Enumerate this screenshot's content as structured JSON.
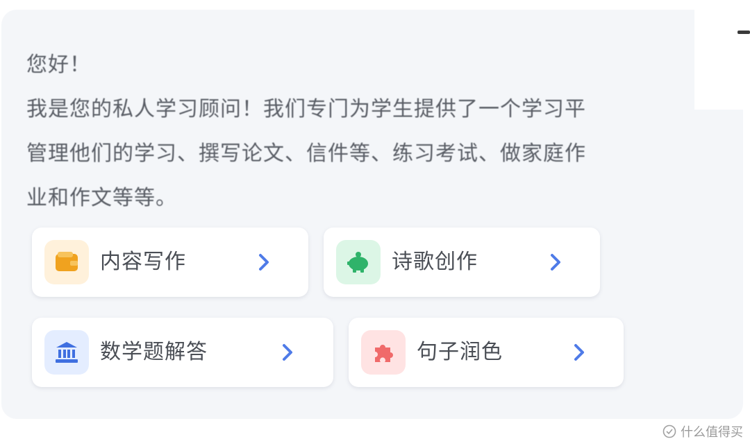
{
  "message": {
    "greeting": "您好！",
    "line1": "我是您的私人学习顾问！我们专门为学生提供了一个学习平",
    "line2": "管理他们的学习、撰写论文、信件等、练习考试、做家庭作",
    "line3": "业和作文等等。"
  },
  "cards": [
    {
      "label": "内容写作",
      "icon": "wallet-icon",
      "icon_bg": "#fff1db",
      "icon_color": "#f0a21f"
    },
    {
      "label": "诗歌创作",
      "icon": "piggy-bank-icon",
      "icon_bg": "#dcf6e6",
      "icon_color": "#2fb36a"
    },
    {
      "label": "数学题解答",
      "icon": "bank-icon",
      "icon_bg": "#e4edff",
      "icon_color": "#3f6fe0"
    },
    {
      "label": "句子润色",
      "icon": "puzzle-icon",
      "icon_bg": "#ffe3e3",
      "icon_color": "#f06a6a"
    }
  ],
  "chevron_color": "#4f7be8",
  "watermark": {
    "text": "什么值得买"
  }
}
